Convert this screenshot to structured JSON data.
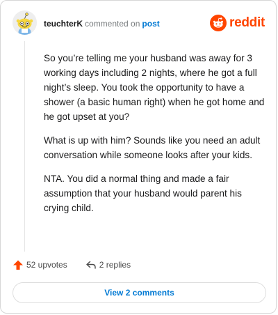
{
  "header": {
    "username": "teuchterK",
    "action_text": "commented on",
    "post_link": "post",
    "brand": "reddit",
    "brand_color": "#ff4500",
    "link_color": "#0079d3"
  },
  "comment": {
    "paragraphs": [
      "So you’re telling me your husband was away for 3 working days including 2 nights, where he got a full night’s sleep. You took the opportunity to have a shower (a basic human right) when he got home and he got upset at you?",
      "What is up with him? Sounds like you need an adult conversation while someone looks after your kids.",
      "NTA. You did a normal thing and made a fair assumption that your husband would parent his crying child."
    ]
  },
  "actions": {
    "upvotes_label": "52 upvotes",
    "replies_label": "2 replies",
    "upvote_icon": "upvote-arrow-icon",
    "reply_icon": "reply-arrow-icon"
  },
  "footer": {
    "view_comments_label": "View 2 comments"
  }
}
